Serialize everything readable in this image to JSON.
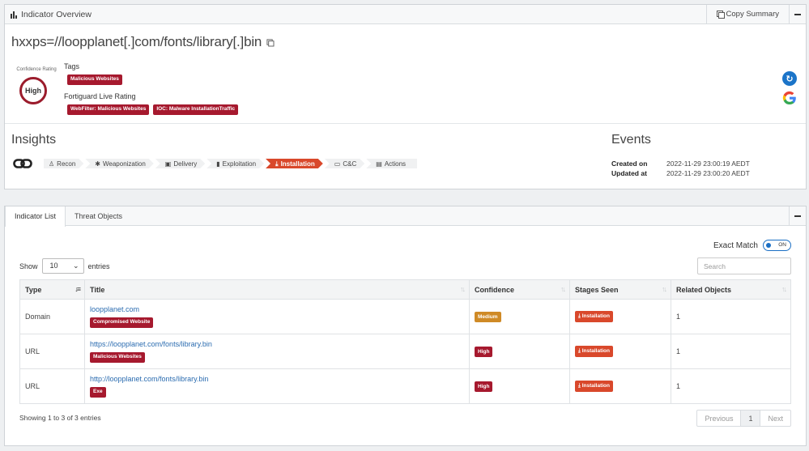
{
  "overview": {
    "header_title": "Indicator Overview",
    "copy_label": "Copy Summary",
    "indicator": "hxxps=//loopplanet[.]com/fonts/library[.]bin",
    "confidence_label": "Confidence Rating",
    "confidence_value": "High",
    "tags_label": "Tags",
    "tags": [
      "Malicious Websites"
    ],
    "fortiguard_label": "Fortiguard Live Rating",
    "fortiguard_tags": [
      "WebFilter: Malicious Websites",
      "IOC: Malware InstallationTraffic"
    ]
  },
  "insights": {
    "title": "Insights",
    "stages": [
      {
        "label": "Recon",
        "icon": "binoculars-icon",
        "glyph": "♙",
        "active": false
      },
      {
        "label": "Weaponization",
        "icon": "gear-icon",
        "glyph": "✱",
        "active": false
      },
      {
        "label": "Delivery",
        "icon": "package-icon",
        "glyph": "▣",
        "active": false
      },
      {
        "label": "Exploitation",
        "icon": "lock-icon",
        "glyph": "▮",
        "active": false
      },
      {
        "label": "Installation",
        "icon": "download-icon",
        "glyph": "⤓",
        "active": true
      },
      {
        "label": "C&C",
        "icon": "laptop-icon",
        "glyph": "▭",
        "active": false
      },
      {
        "label": "Actions",
        "icon": "keyboard-icon",
        "glyph": "▤",
        "active": false
      }
    ]
  },
  "events": {
    "title": "Events",
    "created_label": "Created on",
    "created_value": "2022-11-29 23:00:19 AEDT",
    "updated_label": "Updated at",
    "updated_value": "2022-11-29 23:00:20 AEDT"
  },
  "list": {
    "tabs": [
      "Indicator List",
      "Threat Objects"
    ],
    "exact_match_label": "Exact Match",
    "toggle_state": "ON",
    "show_label": "Show",
    "entries_value": "10",
    "entries_label": "entries",
    "search_placeholder": "Search",
    "columns": [
      "Type",
      "Title",
      "Confidence",
      "Stages Seen",
      "Related Objects"
    ],
    "rows": [
      {
        "type": "Domain",
        "title": "loopplanet.com",
        "tag": "Compromised Website",
        "confidence": "Medium",
        "stage": "Installation",
        "related": "1"
      },
      {
        "type": "URL",
        "title": "https://loopplanet.com/fonts/library.bin",
        "tag": "Malicious Websites",
        "confidence": "High",
        "stage": "Installation",
        "related": "1"
      },
      {
        "type": "URL",
        "title": "http://loopplanet.com/fonts/library.bin",
        "tag": "Exe",
        "confidence": "High",
        "stage": "Installation",
        "related": "1"
      }
    ],
    "showing": "Showing 1 to 3 of 3 entries",
    "pager": {
      "previous": "Previous",
      "page": "1",
      "next": "Next"
    }
  },
  "colors": {
    "brand_red": "#a6192e",
    "stage_orange": "#d9482b",
    "medium_amber": "#cf8a26",
    "link_blue": "#2b6cb0"
  }
}
